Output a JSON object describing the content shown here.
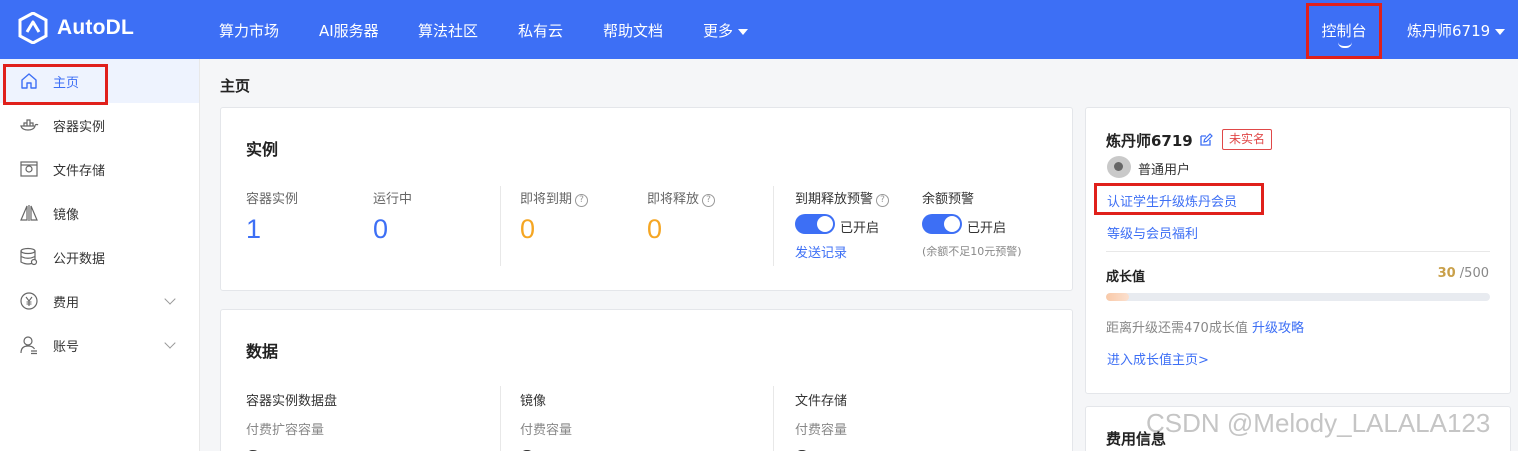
{
  "header": {
    "brand": "AutoDL",
    "nav": [
      "算力市场",
      "AI服务器",
      "算法社区",
      "私有云",
      "帮助文档",
      "更多"
    ],
    "console_label": "控制台",
    "user_menu": "炼丹师6719",
    "bg_color": "#3d6ff5"
  },
  "sidebar": {
    "items": [
      {
        "label": "主页",
        "icon": "home-icon",
        "active": true
      },
      {
        "label": "容器实例",
        "icon": "container-icon"
      },
      {
        "label": "文件存储",
        "icon": "storage-icon"
      },
      {
        "label": "镜像",
        "icon": "mirror-icon"
      },
      {
        "label": "公开数据",
        "icon": "database-icon"
      },
      {
        "label": "费用",
        "icon": "yen-icon",
        "expandable": true
      },
      {
        "label": "账号",
        "icon": "user-icon",
        "expandable": true
      }
    ]
  },
  "main": {
    "page_title": "主页",
    "instances": {
      "title": "实例",
      "container_label": "容器实例",
      "container_value": "1",
      "running_label": "运行中",
      "running_value": "0",
      "expiring_label": "即将到期",
      "expiring_value": "0",
      "releasing_label": "即将释放",
      "releasing_value": "0",
      "release_alert_label": "到期释放预警",
      "release_alert_state": "已开启",
      "send_log_link": "发送记录",
      "balance_alert_label": "余额预警",
      "balance_alert_state": "已开启",
      "balance_alert_note": "(余额不足10元预警)"
    },
    "data": {
      "title": "数据",
      "disk_label": "容器实例数据盘",
      "disk_sub": "付费扩容容量",
      "mirror_label": "镜像",
      "mirror_sub": "付费容量",
      "storage_label": "文件存储",
      "storage_sub": "付费容量"
    }
  },
  "profile": {
    "name": "炼丹师6719",
    "verify_badge": "未实名",
    "level": "普通用户",
    "student_link": "认证学生升级炼丹会员",
    "benefits_link": "等级与会员福利",
    "growth_label": "成长值",
    "growth_current": "30",
    "growth_total": "/500",
    "growth_progress": 0.06,
    "upgrade_hint": "距离升级还需470成长值",
    "upgrade_link": "升级攻略",
    "growth_home_link": "进入成长值主页>",
    "fee_title": "费用信息"
  },
  "watermark": "CSDN @Melody_LALALA123"
}
